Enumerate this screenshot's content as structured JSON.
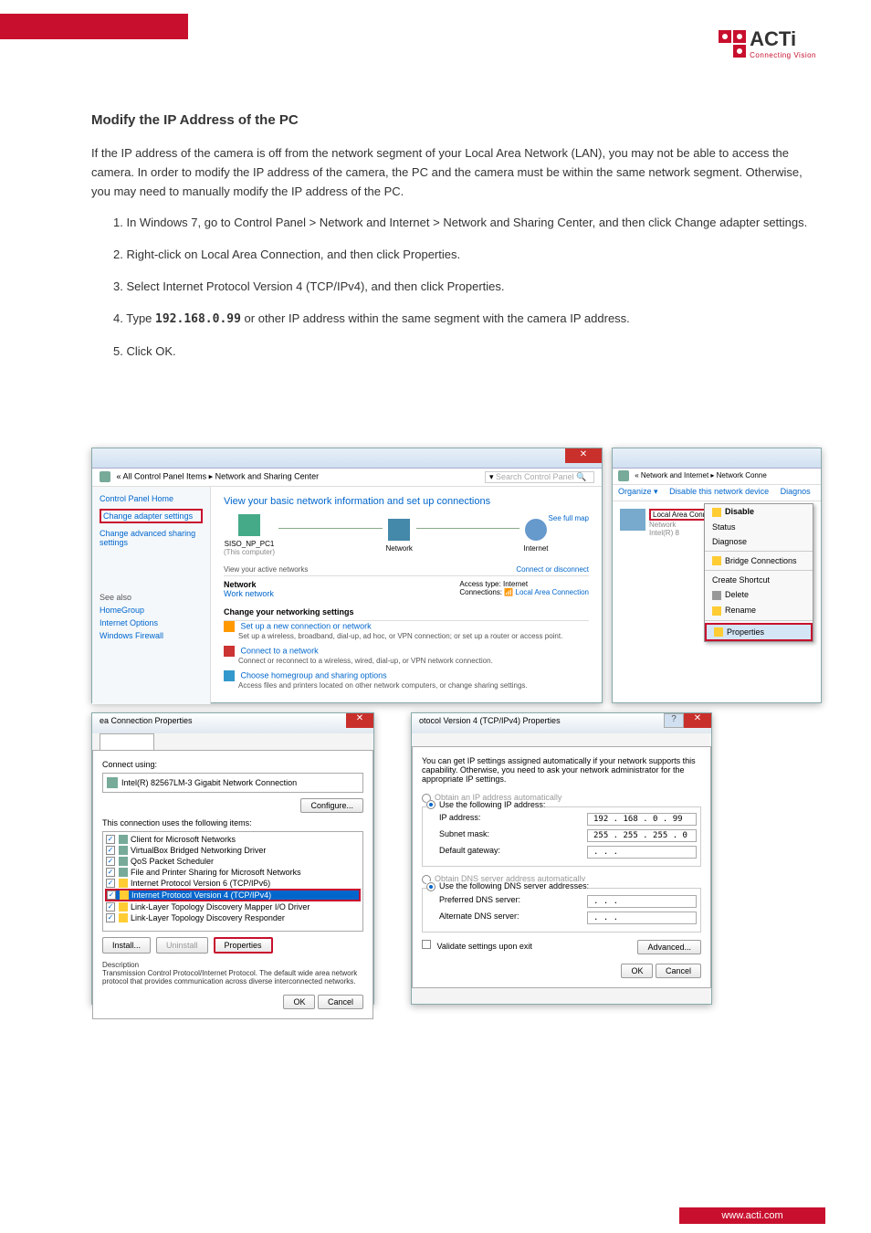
{
  "logo": {
    "text": "ACTi",
    "sub": "Connecting Vision"
  },
  "heading": "Modify the IP Address of the PC",
  "intro": "If the IP address of the camera is off from the network segment of your Local Area Network (LAN), you may not be able to access the camera. In order to modify the IP address of the camera, the PC and the camera must be within the same network segment. Otherwise, you may need to manually modify the IP address of the PC.",
  "step1": "In Windows 7, go to Control Panel > Network and Internet > Network and Sharing Center, and then click Change adapter settings.",
  "step2": "Right-click on Local Area Connection, and then click Properties.",
  "step3": "Select Internet Protocol Version 4 (TCP/IPv4), and then click Properties.",
  "step4_pre": "Type ",
  "step4_ip": "192.168.0.99",
  "step4_post": " or other IP address within the same segment with the camera IP address.",
  "step5": "Click OK.",
  "networkCenter": {
    "crumb": "« All Control Panel Items ▸ Network and Sharing Center",
    "search": "Search Control Panel",
    "panelHome": "Control Panel Home",
    "changeAdapter": "Change adapter settings",
    "changeAdvanced": "Change advanced sharing settings",
    "seeAlso": "See also",
    "homeGroup": "HomeGroup",
    "inetOpts": "Internet Options",
    "firewall": "Windows Firewall",
    "mainH": "View your basic network information and set up connections",
    "fullMap": "See full map",
    "pc": "SISO_NP_PC1",
    "pcSub": "(This computer)",
    "netLabel": "Network",
    "inet": "Internet",
    "viewActive": "View your active networks",
    "connDisc": "Connect or disconnect",
    "netType": "Work network",
    "accType": "Access type:",
    "accVal": "Internet",
    "connLabel": "Connections:",
    "connVal": "Local Area Connection",
    "changeSettings": "Change your networking settings",
    "task1": "Set up a new connection or network",
    "task1d": "Set up a wireless, broadband, dial-up, ad hoc, or VPN connection; or set up a router or access point.",
    "task2": "Connect to a network",
    "task2d": "Connect or reconnect to a wireless, wired, dial-up, or VPN network connection.",
    "task3": "Choose homegroup and sharing options",
    "task3d": "Access files and printers located on other network computers, or change sharing settings."
  },
  "netConn": {
    "crumb": "« Network and Internet ▸ Network Conne",
    "organize": "Organize ▾",
    "disable": "Disable this network device",
    "diagnos": "Diagnos",
    "name": "Local Area Connection",
    "netSub": "Network",
    "nic": "Intel(R) 8",
    "menu": {
      "disable": "Disable",
      "status": "Status",
      "diagnose": "Diagnose",
      "bridge": "Bridge Connections",
      "shortcut": "Create Shortcut",
      "delete": "Delete",
      "rename": "Rename",
      "props": "Properties"
    }
  },
  "connProps": {
    "title": "ea Connection Properties",
    "connectUsing": "Connect using:",
    "nic": "Intel(R) 82567LM-3 Gigabit Network Connection",
    "configure": "Configure...",
    "usesItems": "This connection uses the following items:",
    "items": [
      "Client for Microsoft Networks",
      "VirtualBox Bridged Networking Driver",
      "QoS Packet Scheduler",
      "File and Printer Sharing for Microsoft Networks",
      "Internet Protocol Version 6 (TCP/IPv6)",
      "Internet Protocol Version 4 (TCP/IPv4)",
      "Link-Layer Topology Discovery Mapper I/O Driver",
      "Link-Layer Topology Discovery Responder"
    ],
    "install": "Install...",
    "uninstall": "Uninstall",
    "props": "Properties",
    "descH": "Description",
    "desc": "Transmission Control Protocol/Internet Protocol. The default wide area network protocol that provides communication across diverse interconnected networks.",
    "ok": "OK",
    "cancel": "Cancel"
  },
  "ipv4": {
    "title": "otocol Version 4 (TCP/IPv4) Properties",
    "info": "You can get IP settings assigned automatically if your network supports this capability. Otherwise, you need to ask your network administrator for the appropriate IP settings.",
    "auto": "Obtain an IP address automatically",
    "manual": "Use the following IP address:",
    "ipLbl": "IP address:",
    "ipVal": "192 . 168 .  0  . 99",
    "maskLbl": "Subnet mask:",
    "maskVal": "255 . 255 . 255 .  0",
    "gwLbl": "Default gateway:",
    "gwVal": " .    .    . ",
    "dnsAuto": "Obtain DNS server address automatically",
    "dnsManual": "Use the following DNS server addresses:",
    "dns1Lbl": "Preferred DNS server:",
    "dns2Lbl": "Alternate DNS server:",
    "validate": "Validate settings upon exit",
    "advanced": "Advanced...",
    "ok": "OK",
    "cancel": "Cancel"
  },
  "footer": "www.acti.com"
}
